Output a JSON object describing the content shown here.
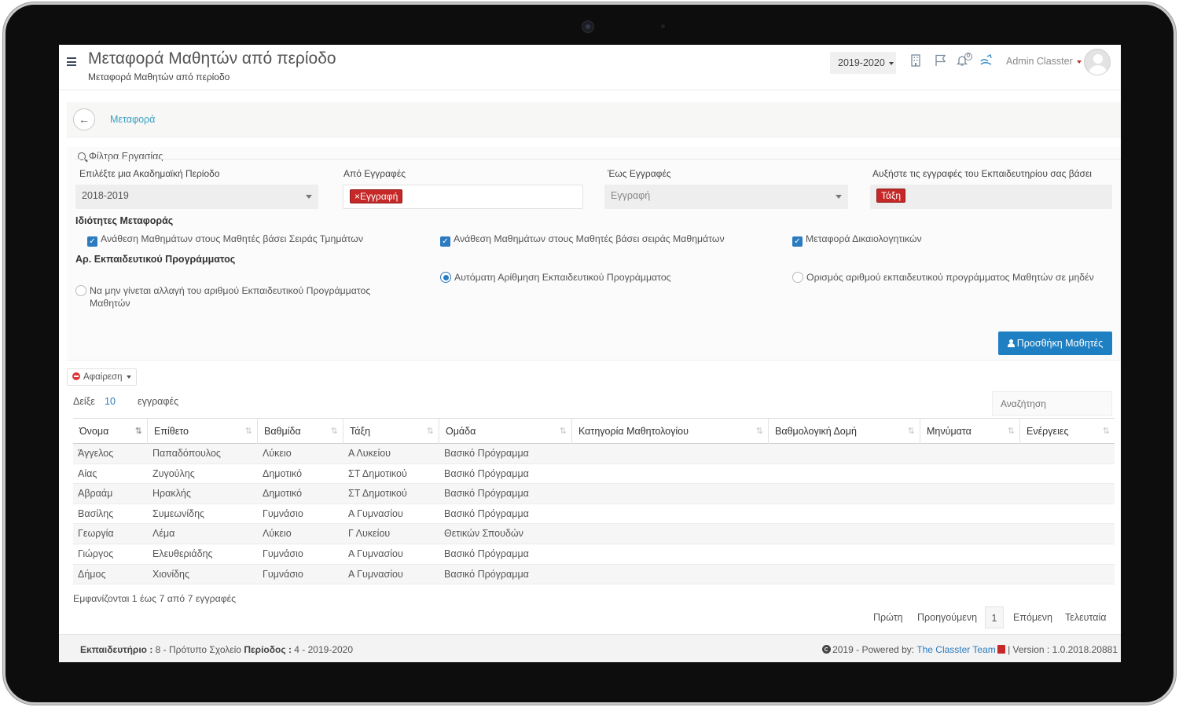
{
  "header": {
    "title": "Μεταφορά Μαθητών από περίοδο",
    "subtitle": "Μεταφορά Μαθητών από περίοδο",
    "period": "2019-2020",
    "notifications_count": "0",
    "user": "Admin Classter"
  },
  "breadcrumb": {
    "current": "Μεταφορά"
  },
  "filters": {
    "title": "Φίλτρα Εργασίας",
    "period_label": "Επιλέξτε μια Ακαδημαϊκή Περίοδο",
    "period_value": "2018-2019",
    "from_label": "Από Εγγραφές",
    "from_tag": "Εγγραφή",
    "to_label": "Έως Εγγραφές",
    "to_value": "Εγγραφή",
    "increase_label": "Αυξήστε τις εγγραφές του Εκπαιδευτηρίου σας βάσει",
    "increase_tag": "Τάξη"
  },
  "transfer": {
    "title": "Ιδιότητες Μεταφοράς",
    "options": [
      "Ανάθεση Μαθημάτων στους Μαθητές βάσει Σειράς Τμημάτων",
      "Ανάθεση Μαθημάτων στους Μαθητές βάσει σειράς Μαθημάτων",
      "Μεταφορά Δικαιολογητικών"
    ]
  },
  "program": {
    "title": "Αρ. Εκπαιδευτικού Προγράμματος",
    "options": [
      "Να μην γίνεται αλλαγή του αριθμού Εκπαιδευτικού Προγράμματος Μαθητών",
      "Αυτόματη Αρίθμηση Εκπαιδευτικού Προγράμματος",
      "Ορισμός αριθμού εκπαιδευτικού προγράμματος Μαθητών σε μηδέν"
    ],
    "selected": 1
  },
  "actions": {
    "add_students": "Προσθήκη Μαθητές",
    "remove": "Αφαίρεση"
  },
  "table_controls": {
    "show": "Δείξε",
    "page_size": "10",
    "entries": "εγγραφές",
    "search_placeholder": "Αναζήτηση"
  },
  "table": {
    "columns": [
      "Όνομα",
      "Επίθετο",
      "Βαθμίδα",
      "Τάξη",
      "Ομάδα",
      "Κατηγορία Μαθητολογίου",
      "Βαθμολογική Δομή",
      "Μηνύματα",
      "Ενέργειες"
    ],
    "rows": [
      [
        "Άγγελος",
        "Παπαδόπουλος",
        "Λύκειο",
        "Α Λυκείου",
        "Βασικό Πρόγραμμα"
      ],
      [
        "Αίας",
        "Ζυγούλης",
        "Δημοτικό",
        "ΣΤ Δημοτικού",
        "Βασικό Πρόγραμμα"
      ],
      [
        "Αβραάμ",
        "Ηρακλής",
        "Δημοτικό",
        "ΣΤ Δημοτικού",
        "Βασικό Πρόγραμμα"
      ],
      [
        "Βασίλης",
        "Συμεωνίδης",
        "Γυμνάσιο",
        "Α Γυμνασίου",
        "Βασικό Πρόγραμμα"
      ],
      [
        "Γεωργία",
        "Λέμα",
        "Λύκειο",
        "Γ Λυκείου",
        "Θετικών Σπουδών"
      ],
      [
        "Γιώργος",
        "Ελευθεριάδης",
        "Γυμνάσιο",
        "Α Γυμνασίου",
        "Βασικό Πρόγραμμα"
      ],
      [
        "Δήμος",
        "Χιονίδης",
        "Γυμνάσιο",
        "Α Γυμνασίου",
        "Βασικό Πρόγραμμα"
      ]
    ],
    "info": "Εμφανίζονται 1 έως 7 από 7 εγγραφές"
  },
  "pagination": {
    "first": "Πρώτη",
    "previous": "Προηγούμενη",
    "page": "1",
    "next": "Επόμενη",
    "last": "Τελευταία"
  },
  "footer": {
    "school_label": "Εκπαιδευτήριο :",
    "school_value": "8 - Πρότυπο Σχολείο",
    "period_label": "Περίοδος :",
    "period_value": "4 - 2019-2020",
    "copyright": "2019 - Powered by:",
    "team": "The Classter Team",
    "version": "| Version : 1.0.2018.20881"
  },
  "colors": {
    "primary": "#1e7fc2",
    "link": "#3aa1c5",
    "tag": "#c62828"
  }
}
